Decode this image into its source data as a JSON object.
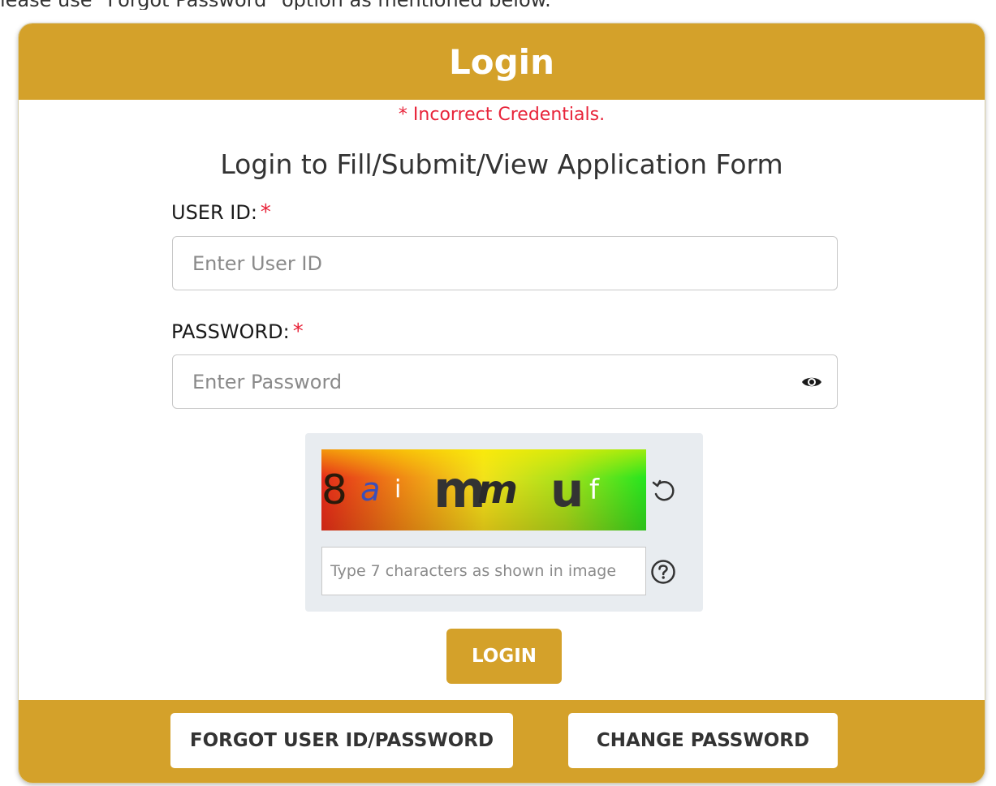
{
  "top_note": "lease use \"Forgot Password\" option as mentioned below.",
  "header": {
    "title": "Login"
  },
  "error_message": "* Incorrect Credentials.",
  "subtitle": "Login to Fill/Submit/View Application Form",
  "user_id": {
    "label": "USER ID:",
    "required_marker": "*",
    "placeholder": "Enter User ID",
    "value": ""
  },
  "password": {
    "label": "PASSWORD:",
    "required_marker": "*",
    "placeholder": "Enter Password",
    "value": "",
    "toggle_icon": "eye-icon"
  },
  "captcha": {
    "image_text": [
      "8",
      "a",
      "i",
      "m",
      "m",
      "u",
      "f"
    ],
    "refresh_icon": "refresh-icon",
    "input_placeholder": "Type 7 characters as shown in image",
    "input_value": "",
    "help_icon": "question-circle-icon"
  },
  "login_button": "LOGIN",
  "footer": {
    "forgot_button": "FORGOT USER ID/PASSWORD",
    "change_password_button": "CHANGE PASSWORD"
  },
  "colors": {
    "accent": "#d4a12a",
    "error": "#e8243a",
    "captcha_panel": "#e8ecf0"
  }
}
